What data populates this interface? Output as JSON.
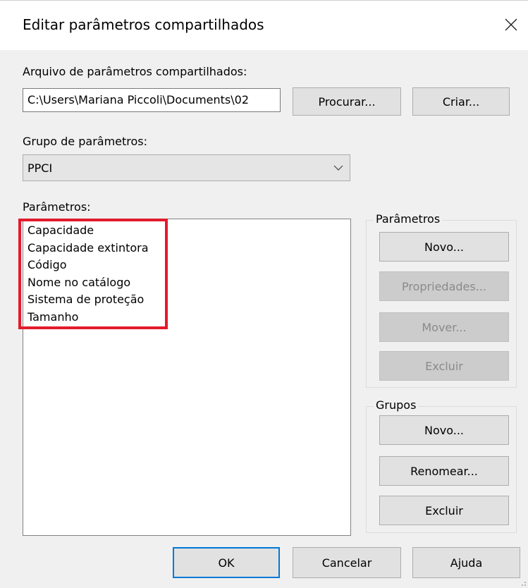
{
  "window": {
    "title": "Editar parâmetros compartilhados"
  },
  "shared_file": {
    "label": "Arquivo de parâmetros compartilhados:",
    "value": "C:\\Users\\Mariana Piccoli\\Documents\\02",
    "browse_label": "Procurar...",
    "create_label": "Criar..."
  },
  "param_group": {
    "label": "Grupo de parâmetros:",
    "selected": "PPCI"
  },
  "parameters": {
    "label": "Parâmetros:",
    "items": [
      "Capacidade",
      "Capacidade extintora",
      "Código",
      "Nome no catálogo",
      "Sistema de proteção",
      "Tamanho"
    ]
  },
  "params_group_box": {
    "legend": "Parâmetros",
    "new_label": "Novo...",
    "properties_label": "Propriedades...",
    "move_label": "Mover...",
    "delete_label": "Excluir"
  },
  "groups_group_box": {
    "legend": "Grupos",
    "new_label": "Novo...",
    "rename_label": "Renomear...",
    "delete_label": "Excluir"
  },
  "footer": {
    "ok_label": "OK",
    "cancel_label": "Cancelar",
    "help_label": "Ajuda"
  },
  "colors": {
    "highlight": "#e21b2c",
    "default_button_border": "#0078d7"
  }
}
